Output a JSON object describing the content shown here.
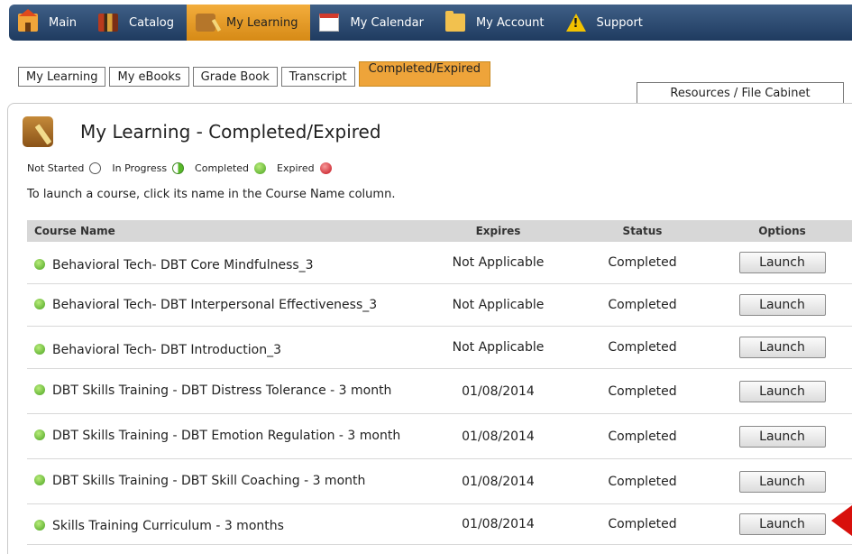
{
  "nav": [
    {
      "label": "Main",
      "icon": "home-icon",
      "active": false
    },
    {
      "label": "Catalog",
      "icon": "books-icon",
      "active": false
    },
    {
      "label": "My Learning",
      "icon": "notebook-icon",
      "active": true
    },
    {
      "label": "My Calendar",
      "icon": "calendar-icon",
      "active": false
    },
    {
      "label": "My Account",
      "icon": "folder-icon",
      "active": false
    },
    {
      "label": "Support",
      "icon": "warning-icon",
      "active": false
    }
  ],
  "tabs": [
    "My Learning",
    "My eBooks",
    "Grade Book",
    "Transcript",
    "Completed/Expired"
  ],
  "tab_resources": "Resources / File Cabinet",
  "page_title": "My Learning - Completed/Expired",
  "legend": {
    "not_started": "Not Started",
    "in_progress": "In Progress",
    "completed": "Completed",
    "expired": "Expired"
  },
  "instruction": "To launch a course, click its name in the Course Name column.",
  "table": {
    "headers": {
      "name": "Course Name",
      "expires": "Expires",
      "status": "Status",
      "options": "Options"
    },
    "rows": [
      {
        "name": "Behavioral Tech- DBT Core Mindfulness_3",
        "expires": "Not Applicable",
        "status": "Completed",
        "action": "Launch"
      },
      {
        "name": "Behavioral Tech- DBT Interpersonal Effectiveness_3",
        "expires": "Not Applicable",
        "status": "Completed",
        "action": "Launch"
      },
      {
        "name": "Behavioral Tech- DBT Introduction_3",
        "expires": "Not Applicable",
        "status": "Completed",
        "action": "Launch"
      },
      {
        "name": "DBT Skills Training - DBT Distress Tolerance - 3 month",
        "expires": "01/08/2014",
        "status": "Completed",
        "action": "Launch"
      },
      {
        "name": "DBT Skills Training - DBT Emotion Regulation - 3 month",
        "expires": "01/08/2014",
        "status": "Completed",
        "action": "Launch"
      },
      {
        "name": "DBT Skills Training - DBT Skill Coaching - 3 month",
        "expires": "01/08/2014",
        "status": "Completed",
        "action": "Launch"
      },
      {
        "name": "Skills Training Curriculum - 3 months",
        "expires": "01/08/2014",
        "status": "Completed",
        "action": "Launch"
      }
    ]
  },
  "colors": {
    "nav_bg": "#2a4a72",
    "active_tab": "#eea43a",
    "completed_green": "#4aa321",
    "expired_red": "#c3101b",
    "marker_red": "#d8100c"
  }
}
